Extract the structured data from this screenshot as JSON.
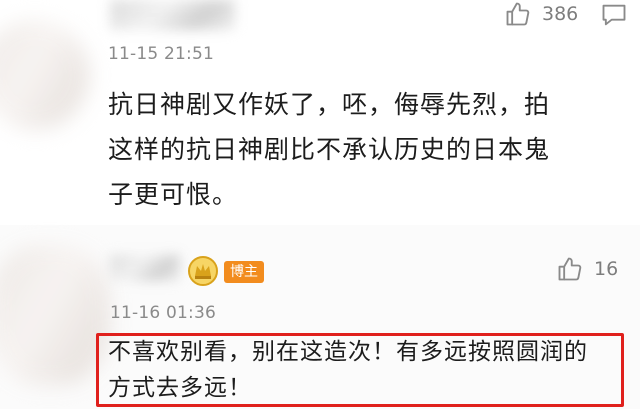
{
  "comments": [
    {
      "likes": "386",
      "timestamp": "11-15 21:51",
      "text_lines": [
        "抗日神剧又作妖了，呸，侮辱先烈，拍",
        "这样的抗日神剧比不承认历史的日本鬼",
        "子更可恨。"
      ]
    },
    {
      "author_badge": "博主",
      "likes": "16",
      "timestamp": "11-16 01:36",
      "text_lines": [
        "不喜欢别看，别在这造次！有多远按照圆润的",
        "方式去多远！"
      ]
    }
  ],
  "colors": {
    "highlight": "#e0201c",
    "badge": "#f28c1e",
    "crown": "#d9a21b",
    "muted": "#8a8a8a"
  },
  "icons": [
    "thumbs-up-icon",
    "reply-icon",
    "crown-badge-icon"
  ]
}
